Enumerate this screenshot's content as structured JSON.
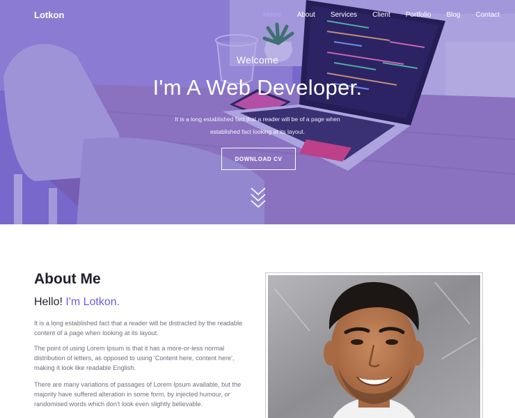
{
  "brand": "Lotkon",
  "nav": [
    "Home",
    "About",
    "Services",
    "Client",
    "Portfolio",
    "Blog",
    "Contact"
  ],
  "hero": {
    "subtitle": "Welcome",
    "title": "I'm A Web Developer.",
    "description": "It is a long established fact that a reader will be of a page when established fact looking at its layout.",
    "cta": "DOWNLOAD CV"
  },
  "about": {
    "heading_bold": "About",
    "heading_rest": " Me",
    "hello": "Hello! ",
    "hello_name": "I'm Lotkon.",
    "paragraphs": [
      "It is a long established fact that a reader will be distracted by the readable content of a page when looking at its layout.",
      "The point of using Lorem Ipsum is that it has a more-or-less normal distribution of letters, as opposed to using 'Content here, content here', making it look like readable English.",
      "There are many variations of passages of Lorem Ipsum available, but the majority have suffered alteration in some form, by injected humour, or randomised words which don't look even slightly believable."
    ]
  },
  "colors": {
    "accent": "#6b5ce7",
    "heading": "#1f1f2e",
    "body_text": "#6e6e7e",
    "hero_overlay": "#5a3fc0"
  },
  "icons": {
    "scroll": "chevron-double-down-icon"
  }
}
